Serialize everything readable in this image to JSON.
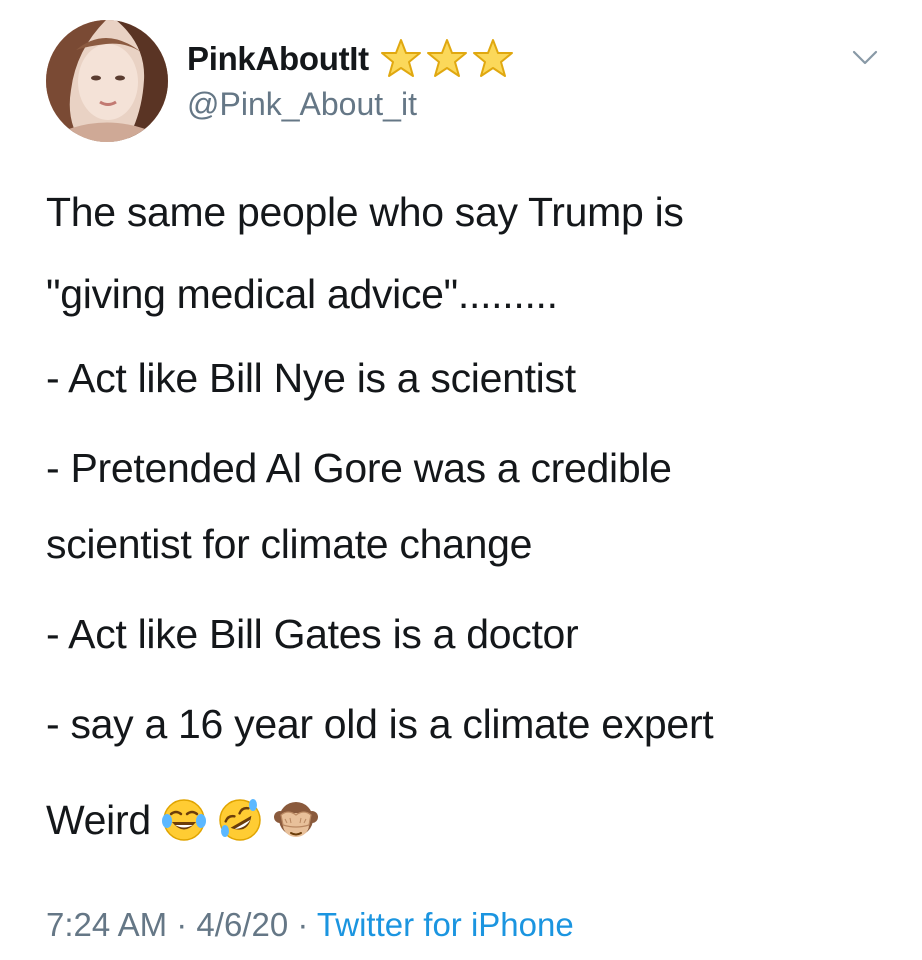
{
  "user": {
    "display_name": "PinkAboutIt",
    "handle": "@Pink_About_it",
    "badge_icons": [
      "star-icon",
      "star-icon",
      "star-icon"
    ]
  },
  "tweet": {
    "lines": [
      "The same people who say Trump is",
      "\"giving medical advice\".........",
      "- Act like Bill Nye is a scientist",
      "- Pretended Al Gore was a credible",
      "scientist for climate change",
      "- Act like Bill Gates is a doctor",
      "- say a 16 year old is a climate expert"
    ],
    "closing_word": "Weird",
    "closing_emojis": [
      "face-with-tears-of-joy-icon",
      "rolling-on-floor-laughing-icon",
      "see-no-evil-monkey-icon"
    ]
  },
  "meta": {
    "time": "7:24 AM",
    "separator": "·",
    "date": "4/6/20",
    "source": "Twitter for iPhone"
  },
  "colors": {
    "text": "#14171a",
    "muted": "#657786",
    "link": "#1b95e0",
    "star": "#f5c518"
  }
}
